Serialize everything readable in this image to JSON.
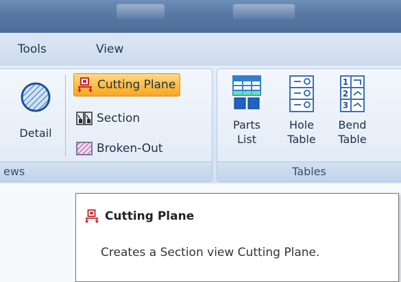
{
  "menubar": {
    "items": [
      "Tools",
      "View"
    ]
  },
  "views_group": {
    "label": "ews",
    "detail_label": "Detail",
    "buttons": [
      {
        "label": "Cutting Plane",
        "icon": "cutting-plane-icon",
        "active": true
      },
      {
        "label": "Section",
        "icon": "section-icon",
        "active": false
      },
      {
        "label": "Broken-Out",
        "icon": "broken-out-icon",
        "active": false
      }
    ]
  },
  "tables_group": {
    "label": "Tables",
    "buttons": [
      {
        "line1": "Parts",
        "line2": "List",
        "icon": "parts-list-icon"
      },
      {
        "line1": "Hole",
        "line2": "Table",
        "icon": "hole-table-icon"
      },
      {
        "line1": "Bend",
        "line2": "Table",
        "icon": "bend-table-icon"
      }
    ]
  },
  "tooltip": {
    "title": "Cutting Plane",
    "description": "Creates a Section view Cutting Plane."
  },
  "colors": {
    "active_button": "#ffbe45",
    "titlebar": "#5878a4",
    "ribbon": "#dde8f5"
  }
}
